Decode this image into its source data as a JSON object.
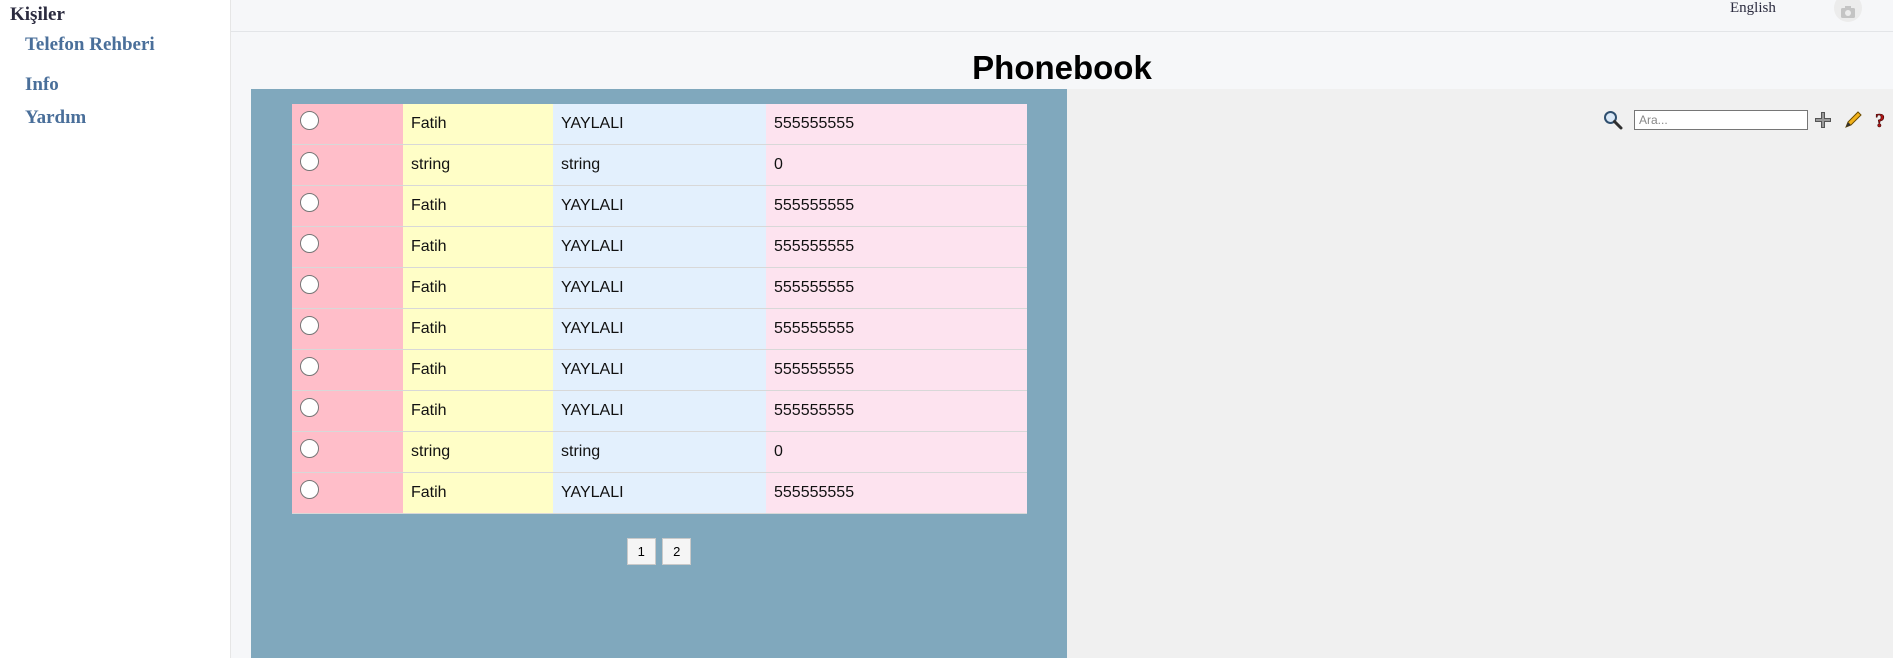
{
  "sidebar": {
    "title": "Kişiler",
    "links": [
      "Telefon Rehberi",
      "Info",
      "Yardım"
    ]
  },
  "topbar": {
    "language": "English"
  },
  "page": {
    "title": "Phonebook"
  },
  "table": {
    "rows": [
      [
        "Fatih",
        "YAYLALI",
        "555555555"
      ],
      [
        "string",
        "string",
        "0"
      ],
      [
        "Fatih",
        "YAYLALI",
        "555555555"
      ],
      [
        "Fatih",
        "YAYLALI",
        "555555555"
      ],
      [
        "Fatih",
        "YAYLALI",
        "555555555"
      ],
      [
        "Fatih",
        "YAYLALI",
        "555555555"
      ],
      [
        "Fatih",
        "YAYLALI",
        "555555555"
      ],
      [
        "Fatih",
        "YAYLALI",
        "555555555"
      ],
      [
        "string",
        "string",
        "0"
      ],
      [
        "Fatih",
        "YAYLALI",
        "555555555"
      ]
    ]
  },
  "pager": {
    "pages": [
      "1",
      "2"
    ]
  },
  "toolbar": {
    "search_placeholder": "Ara...",
    "icons": [
      "search-icon",
      "add-icon",
      "edit-icon",
      "help-icon",
      "remove-icon"
    ]
  },
  "colors": {
    "col_radio": "#ffbec9",
    "col_name": "#fffec7",
    "col_surname": "#e3f0fd",
    "col_phone": "#fde3ef",
    "grid_panel": "#80a8bd",
    "link": "#4a6f9a"
  }
}
